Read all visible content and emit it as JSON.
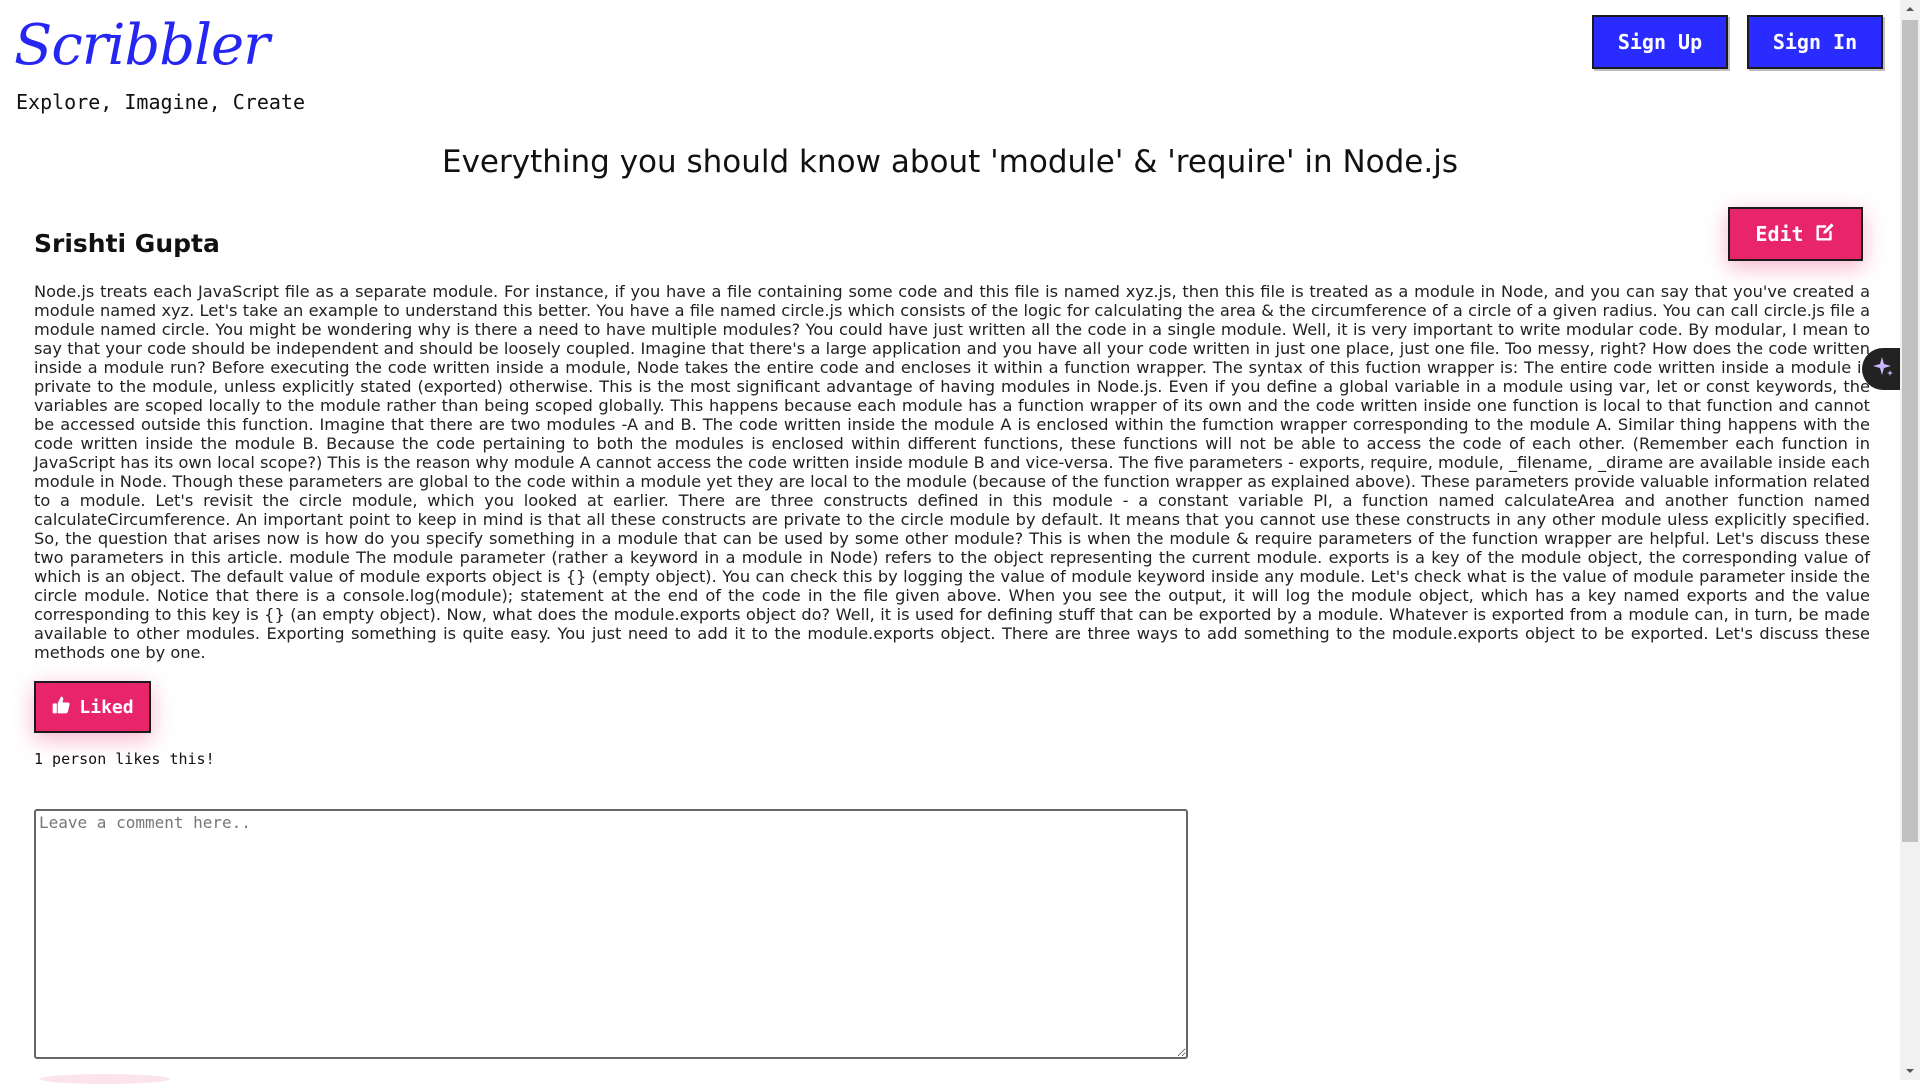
{
  "header": {
    "brand": "Scribbler",
    "tagline": "Explore, Imagine, Create",
    "signup_label": "Sign Up",
    "signin_label": "Sign In"
  },
  "post": {
    "title": "Everything you should know about 'module' & 'require' in Node.js",
    "author": "Srishti Gupta",
    "edit_label": "Edit",
    "body": "Node.js treats each JavaScript file as a separate module. For instance, if you have a file containing some code and this file is named xyz.js, then this file is treated as a module in Node, and you can say that you've created a module named xyz. Let's take an example to understand this better. You have a file named circle.js which consists of the logic for calculating the area & the circumference of a circle of a given radius. You can call circle.js file a module named circle. You might be wondering why is there a need to have multiple modules? You could have just written all the code in a single module. Well, it is very important to write modular code. By modular, I mean to say that your code should be independent and should be loosely coupled. Imagine that there's a large application and you have all your code written in just one place, just one file. Too messy, right? How does the code written inside a module run? Before executing the code written inside a module, Node takes the entire code and encloses it within a function wrapper. The syntax of this fuction wrapper is: The entire code written inside a module is private to the module, unless explicitly stated (exported) otherwise. This is the most significant advantage of having modules in Node.js. Even if you define a global variable in a module using var, let or const keywords, the variables are scoped locally to the module rather than being scoped globally. This happens because each module has a function wrapper of its own and the code written inside one function is local to that function and cannot be accessed outside this function. Imagine that there are two modules -A and B. The code written inside the module A is enclosed within the fumction wrapper corresponding to the module A. Similar thing happens with the code written inside the module B. Because the code pertaining to both the modules is enclosed within different functions, these functions will not be able to access the code of each other. (Remember each function in JavaScript has its own local scope?) This is the reason why module A cannot access the code written inside module B and vice-versa. The five parameters - exports, require, module, _filename, _dirame are available inside each module in Node. Though these parameters are global to the code within a module yet they are local to the module (because of the function wrapper as explained above). These parameters provide valuable information related to a module. Let's revisit the circle module, which you looked at earlier. There are three constructs defined in this module - a constant variable PI, a function named calculateArea and another function named calculateCircumference. An important point to keep in mind is that all these constructs are private to the circle module by default. It means that you cannot use these constructs in any other module uless explicitly specified. So, the question that arises now is how do you specify something in a module that can be used by some other module? This is when the module & require parameters of the function wrapper are helpful. Let's discuss these two parameters in this article. module The module parameter (rather a keyword in a module in Node) refers to the object representing the current module. exports is a key of the module object, the corresponding value of which is an object. The default value of module exports object is {} (empty object). You can check this by logging the value of module keyword inside any module. Let's check what is the value of module parameter inside the circle module. Notice that there is a console.log(module); statement at the end of the code in the file given above. When you see the output, it will log the module object, which has a key named exports and the value corresponding to this key is {} (an empty object). Now, what does the module.exports object do? Well, it is used for defining stuff that can be exported by a module. Whatever is exported from a module can, in turn, be made available to other modules. Exporting something is quite easy. You just need to add it to the module.exports object. There are three ways to add something to the module.exports object to be exported. Let's discuss these methods one by one.",
    "like_label": "Liked",
    "likes_text": "1 person likes this!"
  },
  "comment": {
    "placeholder": "Leave a comment here.."
  },
  "colors": {
    "brand": "#2626f2",
    "header_button": "#2a2cff",
    "accent": "#e8246a"
  },
  "icons": {
    "edit": "edit-square-icon",
    "like": "thumbs-up-icon",
    "assistant": "sparkle-icon"
  }
}
